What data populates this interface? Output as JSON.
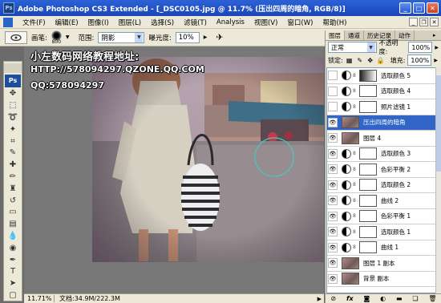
{
  "window": {
    "title": "Adobe Photoshop CS3 Extended - [_DSC0105.jpg @ 11.7% (压出四周的暗角, RGB/8)]",
    "app_logo": "Ps"
  },
  "menu": [
    "文件(F)",
    "编辑(E)",
    "图像(I)",
    "图层(L)",
    "选择(S)",
    "滤镜(T)",
    "Analysis",
    "视图(V)",
    "窗口(W)",
    "帮助(H)"
  ],
  "options": {
    "brush_label": "画笔:",
    "brush_size": "800",
    "range_label": "范围:",
    "range_value": "阴影",
    "exposure_label": "曝光度:",
    "exposure_value": "10%"
  },
  "overlay": {
    "line1": "小左数码网络教程地址:",
    "line2": "HTTP://578094297.QZONE.QQ.COM",
    "line3": "QQ:578094297"
  },
  "status": {
    "zoom": "11.71%",
    "doc": "文档:34.9M/222.3M"
  },
  "panel": {
    "tabs": [
      "图层",
      "通道",
      "历史记录",
      "动作"
    ],
    "blend_mode": "正常",
    "opacity_label": "不透明度:",
    "opacity_value": "100%",
    "lock_label": "锁定:",
    "fill_label": "填充:",
    "fill_value": "100%",
    "layers": [
      {
        "name": "选取颜色 5",
        "visible": false,
        "type": "adj",
        "mask": "grad"
      },
      {
        "name": "选取颜色 4",
        "visible": false,
        "type": "adj",
        "mask": "white"
      },
      {
        "name": "照片滤镜 1",
        "visible": false,
        "type": "adj",
        "mask": "white"
      },
      {
        "name": "压出四周的暗角",
        "visible": true,
        "type": "pixel",
        "selected": true
      },
      {
        "name": "图层 4",
        "visible": true,
        "type": "pixel"
      },
      {
        "name": "选取颜色 3",
        "visible": true,
        "type": "adj",
        "mask": "white"
      },
      {
        "name": "色彩平衡 2",
        "visible": true,
        "type": "adj",
        "mask": "white"
      },
      {
        "name": "选取颜色 2",
        "visible": true,
        "type": "adj",
        "mask": "white"
      },
      {
        "name": "曲线 2",
        "visible": true,
        "type": "adj",
        "mask": "white"
      },
      {
        "name": "色彩平衡 1",
        "visible": true,
        "type": "adj",
        "mask": "white"
      },
      {
        "name": "选取颜色 1",
        "visible": true,
        "type": "adj",
        "mask": "white"
      },
      {
        "name": "曲线 1",
        "visible": true,
        "type": "adj",
        "mask": "white"
      },
      {
        "name": "图层 1 副本",
        "visible": true,
        "type": "pixel"
      },
      {
        "name": "背景 副本",
        "visible": true,
        "type": "pixel"
      }
    ],
    "bottom_icons": [
      "link-icon",
      "fx-icon",
      "mask-icon",
      "adjustment-icon",
      "folder-icon",
      "new-layer-icon",
      "trash-icon"
    ]
  }
}
